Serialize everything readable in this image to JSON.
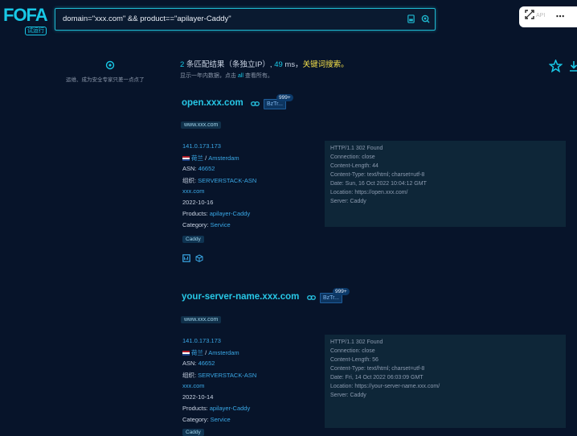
{
  "brand": {
    "logo": "FOFA",
    "badge": "试运行"
  },
  "search": {
    "query": "domain=\"xxx.com\" && product==\"apilayer-Caddy\""
  },
  "topright": {
    "label": "API"
  },
  "sidebar": {
    "tip": "运维、成为安全专家只差一点点了"
  },
  "summary": {
    "count": "2",
    "text_a": " 条匹配结果（",
    "text_b": "条独立IP）, ",
    "ms": "49",
    "ms_unit": " ms，",
    "keyword_search": "关键词搜索。",
    "line2_a": "显示一年内数据，点击 ",
    "line2_all": "all",
    "line2_b": " 查看所有。"
  },
  "results": [
    {
      "host": "open.xxx.com",
      "pill": "BzTr...",
      "count": "999+",
      "domain_tag": "www.xxx.com",
      "ip": "141.0.173.173",
      "country": "荷兰",
      "city": "Amsterdam",
      "asn_label": "ASN: ",
      "asn": "46652",
      "org_label": "组织: ",
      "org": "SERVERSTACK-ASN",
      "domain": "xxx.com",
      "date": "2022-10-16",
      "products_label": "Products: ",
      "product": "apilayer-Caddy",
      "category_label": "Category: ",
      "category": "Service",
      "tag": "Caddy",
      "response": [
        "HTTP/1.1 302 Found",
        "Connection: close",
        "Content-Length: 44",
        "Content-Type: text/html; charset=utf-8",
        "Date: Sun, 16 Oct 2022 10:04:12 GMT",
        "Location: https://open.xxx.com/",
        "Server: Caddy"
      ]
    },
    {
      "host": "your-server-name.xxx.com",
      "pill": "BzTr...",
      "count": "999+",
      "domain_tag": "www.xxx.com",
      "ip": "141.0.173.173",
      "country": "荷兰",
      "city": "Amsterdam",
      "asn_label": "ASN: ",
      "asn": "46652",
      "org_label": "组织: ",
      "org": "SERVERSTACK-ASN",
      "domain": "xxx.com",
      "date": "2022-10-14",
      "products_label": "Products: ",
      "product": "apilayer-Caddy",
      "category_label": "Category: ",
      "category": "Service",
      "tag": "Caddy",
      "response": [
        "HTTP/1.1 302 Found",
        "Connection: close",
        "Content-Length: 56",
        "Content-Type: text/html; charset=utf-8",
        "Date: Fri, 14 Oct 2022 06:03:09 GMT",
        "Location: https://your-server-name.xxx.com/",
        "Server: Caddy"
      ]
    }
  ]
}
